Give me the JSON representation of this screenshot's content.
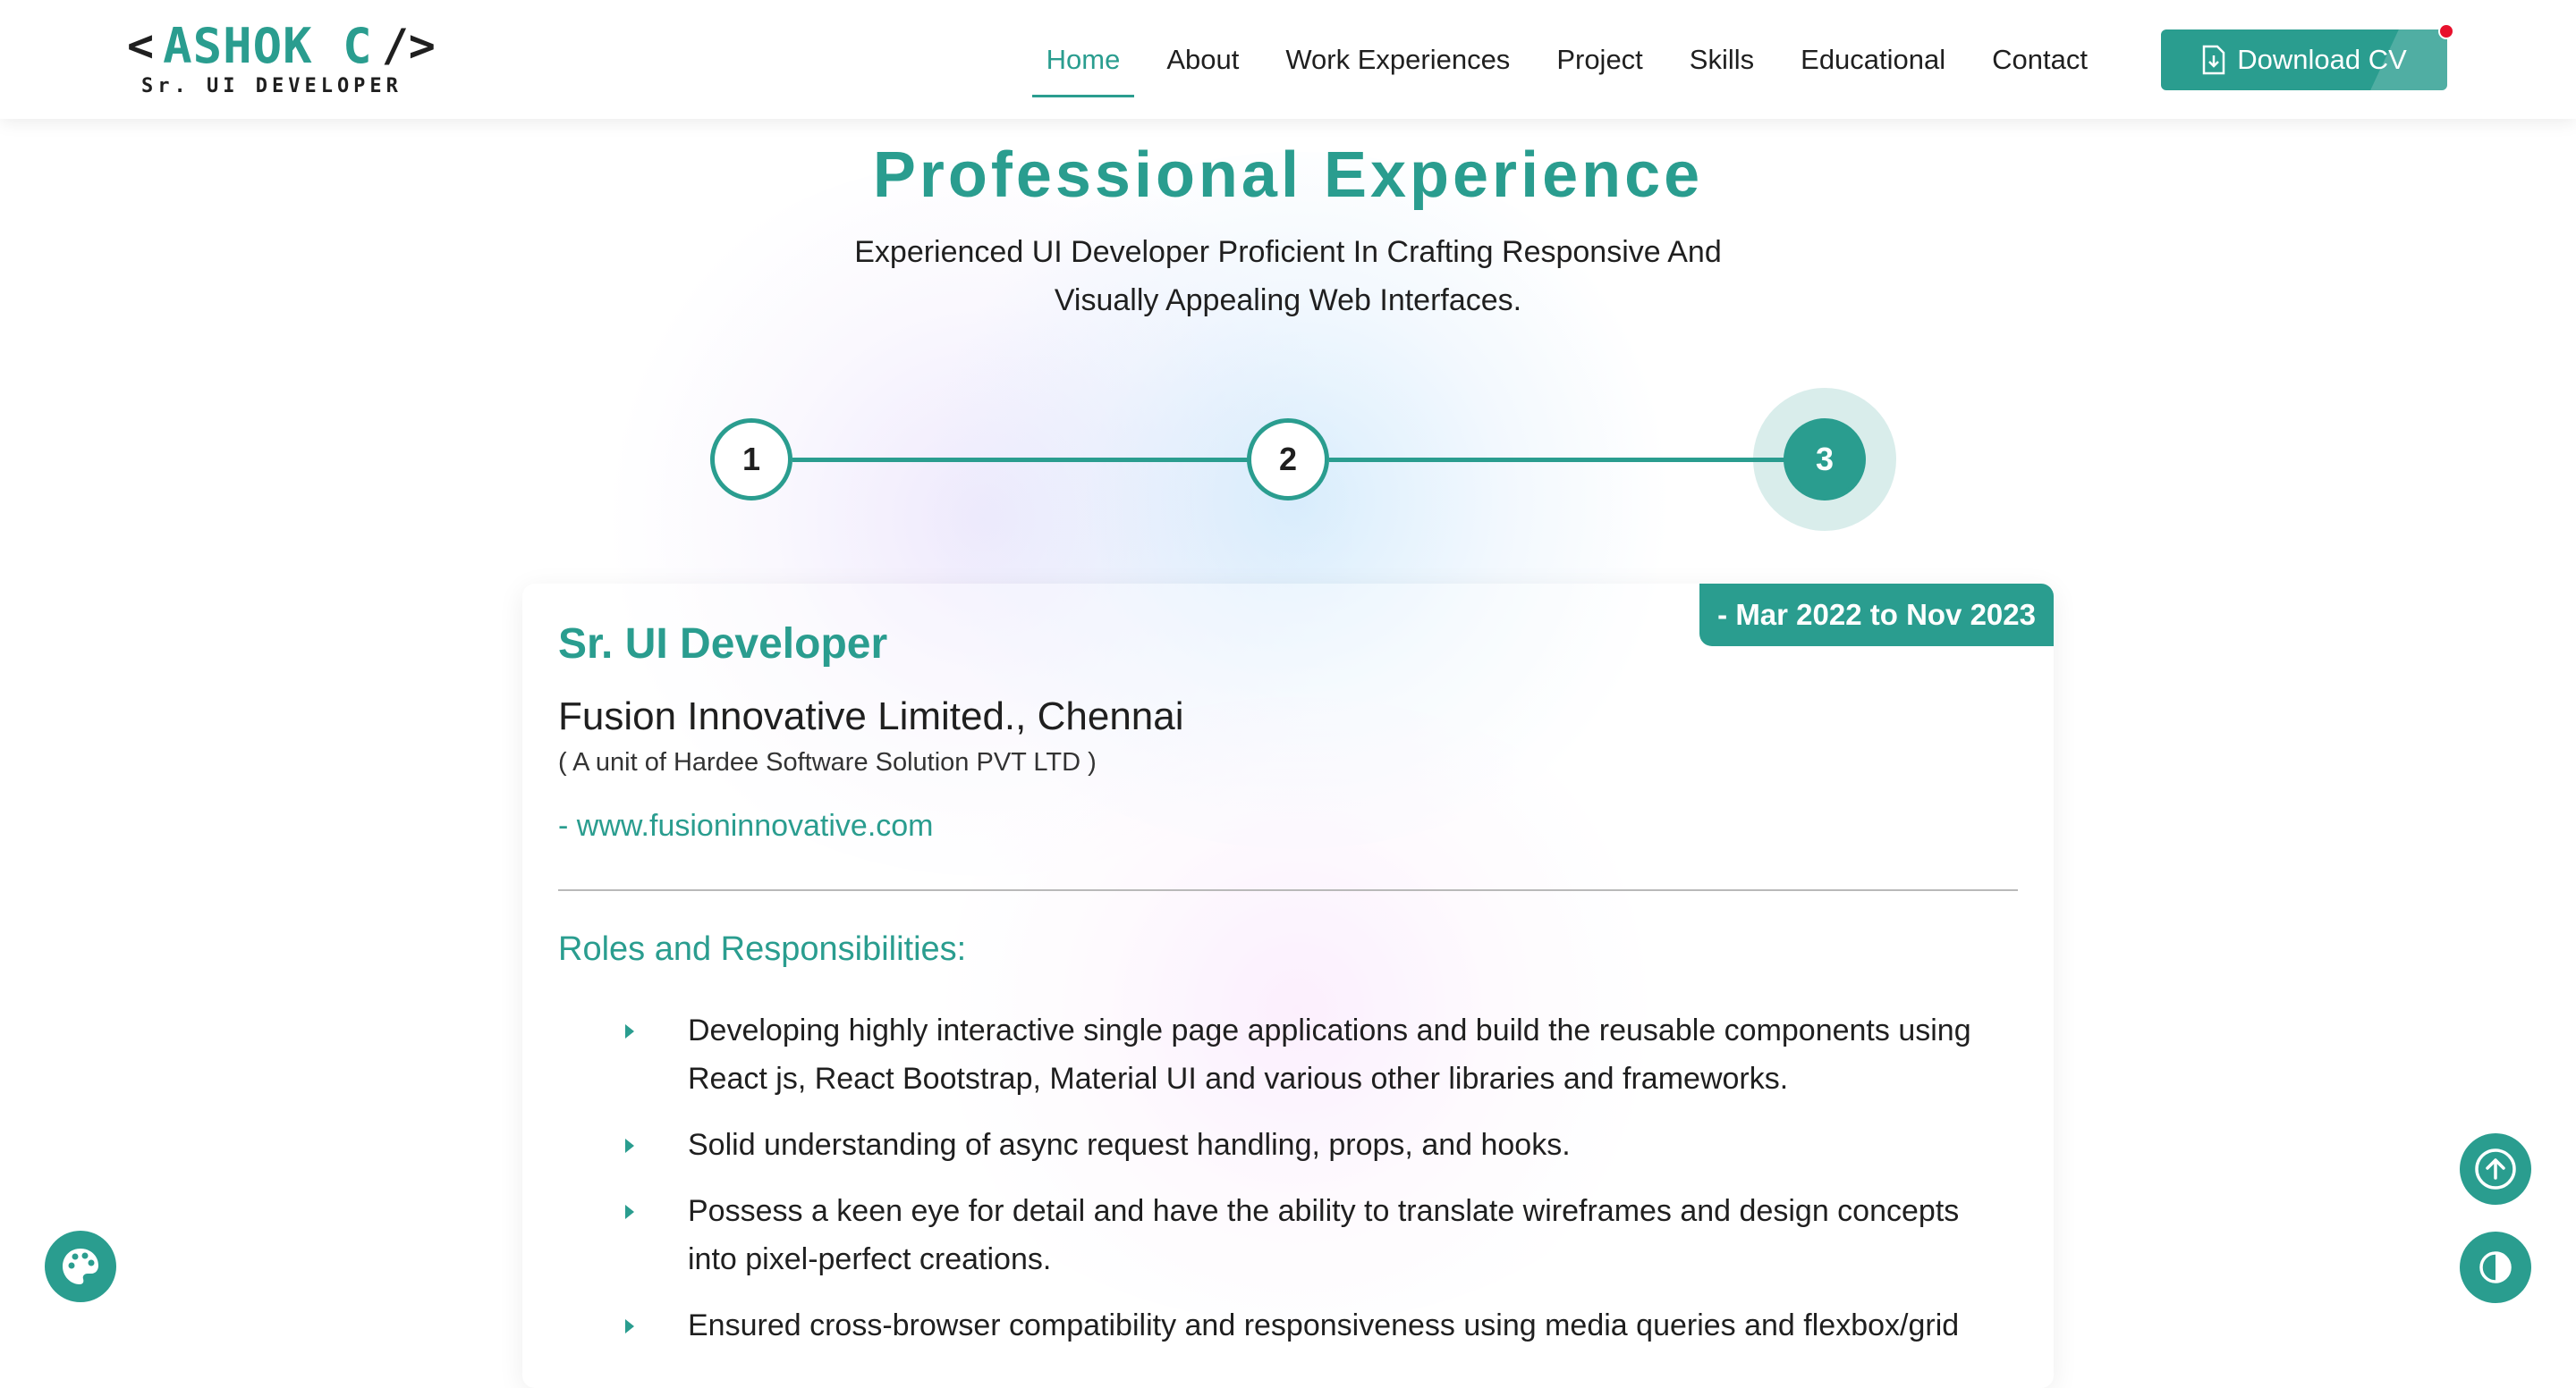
{
  "logo": {
    "open_bracket": "<",
    "name": "ASHOK C",
    "close_bracket": "/>",
    "subtitle": "Sr. UI DEVELOPER"
  },
  "nav": {
    "items": [
      "Home",
      "About",
      "Work Experiences",
      "Project",
      "Skills",
      "Educational",
      "Contact"
    ],
    "active": "Home",
    "download_label": "Download CV"
  },
  "section": {
    "title": "Professional Experience",
    "subtitle": "Experienced UI Developer Proficient In Crafting Responsive And Visually Appealing Web Interfaces."
  },
  "stepper": {
    "steps": [
      "1",
      "2",
      "3"
    ],
    "active_step": "3"
  },
  "experience": {
    "date_range": "- Mar 2022 to Nov 2023",
    "job_title": "Sr. UI Developer",
    "company": "Fusion Innovative Limited., Chennai",
    "unit": "( A unit of Hardee Software Solution PVT LTD )",
    "website": "- www.fusioninnovative.com",
    "roles_title": "Roles and Responsibilities:",
    "roles": [
      "Developing highly interactive single page applications and build the reusable components using React js, React Bootstrap, Material UI and various other libraries and frameworks.",
      "Solid understanding of async request handling, props, and hooks.",
      "Possess a keen eye for detail and have the ability to translate wireframes and design concepts into pixel-perfect creations.",
      "Ensured cross-browser compatibility and responsiveness using media queries and flexbox/grid"
    ]
  },
  "colors": {
    "accent": "#2a9d8f",
    "text": "#1f1f1f",
    "notification_dot": "#e8112d"
  },
  "icons": {
    "download": "file-download-icon",
    "scroll_top": "arrow-up-circle-icon",
    "theme": "contrast-icon",
    "palette": "palette-icon",
    "bullet": "caret-right-icon"
  }
}
